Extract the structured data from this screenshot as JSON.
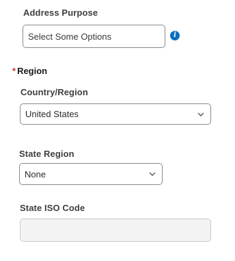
{
  "address_purpose": {
    "label": "Address Purpose",
    "placeholder": "Select Some Options",
    "info_icon": "info-icon"
  },
  "region": {
    "required_marker": "*",
    "title": "Region",
    "country": {
      "label": "Country/Region",
      "value": "United States"
    },
    "state": {
      "label": "State Region",
      "value": "None"
    },
    "iso": {
      "label": "State ISO Code",
      "value": ""
    }
  }
}
